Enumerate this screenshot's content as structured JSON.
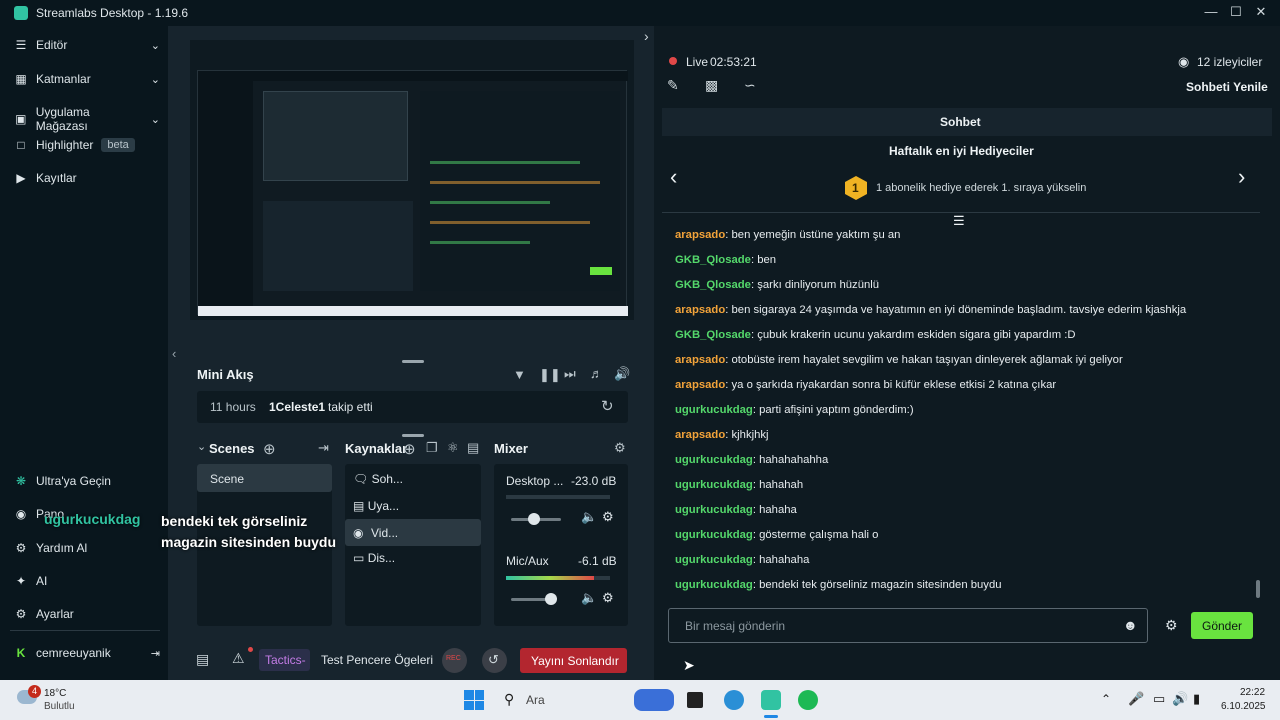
{
  "window": {
    "title": "Streamlabs Desktop - 1.19.6"
  },
  "sidebar": {
    "items": [
      {
        "label": "Editör"
      },
      {
        "label": "Katmanlar"
      },
      {
        "label": "Uygulama Mağazası"
      },
      {
        "label": "Highlighter",
        "badge": "beta"
      },
      {
        "label": "Kayıtlar"
      }
    ],
    "bottom": [
      {
        "label": "Ultra'ya Geçin"
      },
      {
        "label": "Pano"
      },
      {
        "label": "Yardım Al"
      },
      {
        "label": "AI"
      },
      {
        "label": "Ayarlar"
      }
    ],
    "user": "cemreeuyanik"
  },
  "overlay": {
    "username": "ugurkucukdag",
    "message": "bendeki tek görseliniz magazin sitesinden buydu",
    "line1": "bendeki tek görseliniz",
    "line2": "magazin sitesinden buydu"
  },
  "mini_feed": {
    "title": "Mini Akış",
    "time": "11 hours",
    "user": "1Celeste1",
    "action": "takip etti"
  },
  "scenes": {
    "title": "Scenes",
    "items": [
      "Scene"
    ]
  },
  "sources": {
    "title": "Kaynaklar",
    "items": [
      "Soh...",
      "Uya...",
      "Vid...",
      "Dis..."
    ]
  },
  "mixer": {
    "title": "Mixer",
    "channels": [
      {
        "name": "Desktop ...",
        "db": "-23.0 dB",
        "level": 0.0,
        "volume": 0.45
      },
      {
        "name": "Mic/Aux",
        "db": "-6.1 dB",
        "level": 0.85,
        "volume": 0.75
      }
    ]
  },
  "bottombar": {
    "tactics": "Tactics-",
    "test": "Test Pencere Ögeleri",
    "rec": "REC",
    "end_stream": "Yayını Sonlandır"
  },
  "chat": {
    "live_label": "Live",
    "live_time": "02:53:21",
    "viewers": "12 izleyiciler",
    "refresh": "Sohbeti Yenile",
    "title": "Sohbet",
    "gifters_title": "Haftalık en iyi Hediyeciler",
    "gifter_rank": "1",
    "gifter_text": "1 abonelik hediye ederek 1. sıraya yükselin",
    "messages": [
      {
        "user": "arapsado",
        "color": "orange",
        "text": ": ben yemeğin üstüne yaktım şu an"
      },
      {
        "user": "GKB_Qlosade",
        "color": "green",
        "text": ": ben"
      },
      {
        "user": "GKB_Qlosade",
        "color": "green",
        "text": ": şarkı dinliyorum hüzünlü"
      },
      {
        "user": "arapsado",
        "color": "orange",
        "text": ": ben sigaraya 24 yaşımda ve hayatımın en iyi döneminde başladım. tavsiye ederim kjashkja"
      },
      {
        "user": "GKB_Qlosade",
        "color": "green",
        "text": ": çubuk krakerin ucunu yakardım eskiden sigara gibi yapardım :D"
      },
      {
        "user": "arapsado",
        "color": "orange",
        "text": ": otobüste irem hayalet sevgilim ve hakan taşıyan dinleyerek ağlamak iyi geliyor"
      },
      {
        "user": "arapsado",
        "color": "orange",
        "text": ": ya o şarkıda riyakardan sonra bi küfür eklese etkisi 2 katına çıkar"
      },
      {
        "user": "ugurkucukdag",
        "color": "green",
        "text": ": parti afişini yaptım gönderdim:)"
      },
      {
        "user": "arapsado",
        "color": "orange",
        "text": ": kjhkjhkj"
      },
      {
        "user": "ugurkucukdag",
        "color": "green",
        "text": ": hahahahahha"
      },
      {
        "user": "ugurkucukdag",
        "color": "green",
        "text": ": hahahah"
      },
      {
        "user": "ugurkucukdag",
        "color": "green",
        "text": ": hahaha"
      },
      {
        "user": "ugurkucukdag",
        "color": "green",
        "text": ": gösterme çalışma hali o"
      },
      {
        "user": "ugurkucukdag",
        "color": "green",
        "text": ": hahahaha"
      },
      {
        "user": "ugurkucukdag",
        "color": "green",
        "text": ": bendeki tek görseliniz magazin sitesinden buydu"
      }
    ],
    "input_placeholder": "Bir mesaj gönderin",
    "send": "Gönder"
  },
  "taskbar": {
    "weather_temp": "18°C",
    "weather_desc": "Bulutlu",
    "weather_badge": "4",
    "search": "Ara",
    "time": "22:22",
    "date": "6.10.2025"
  },
  "colors": {
    "accent": "#31c3a2",
    "send": "#69e33f",
    "end_stream": "#b3262f",
    "orange_user": "#f2a33a",
    "green_user": "#54d86b"
  }
}
